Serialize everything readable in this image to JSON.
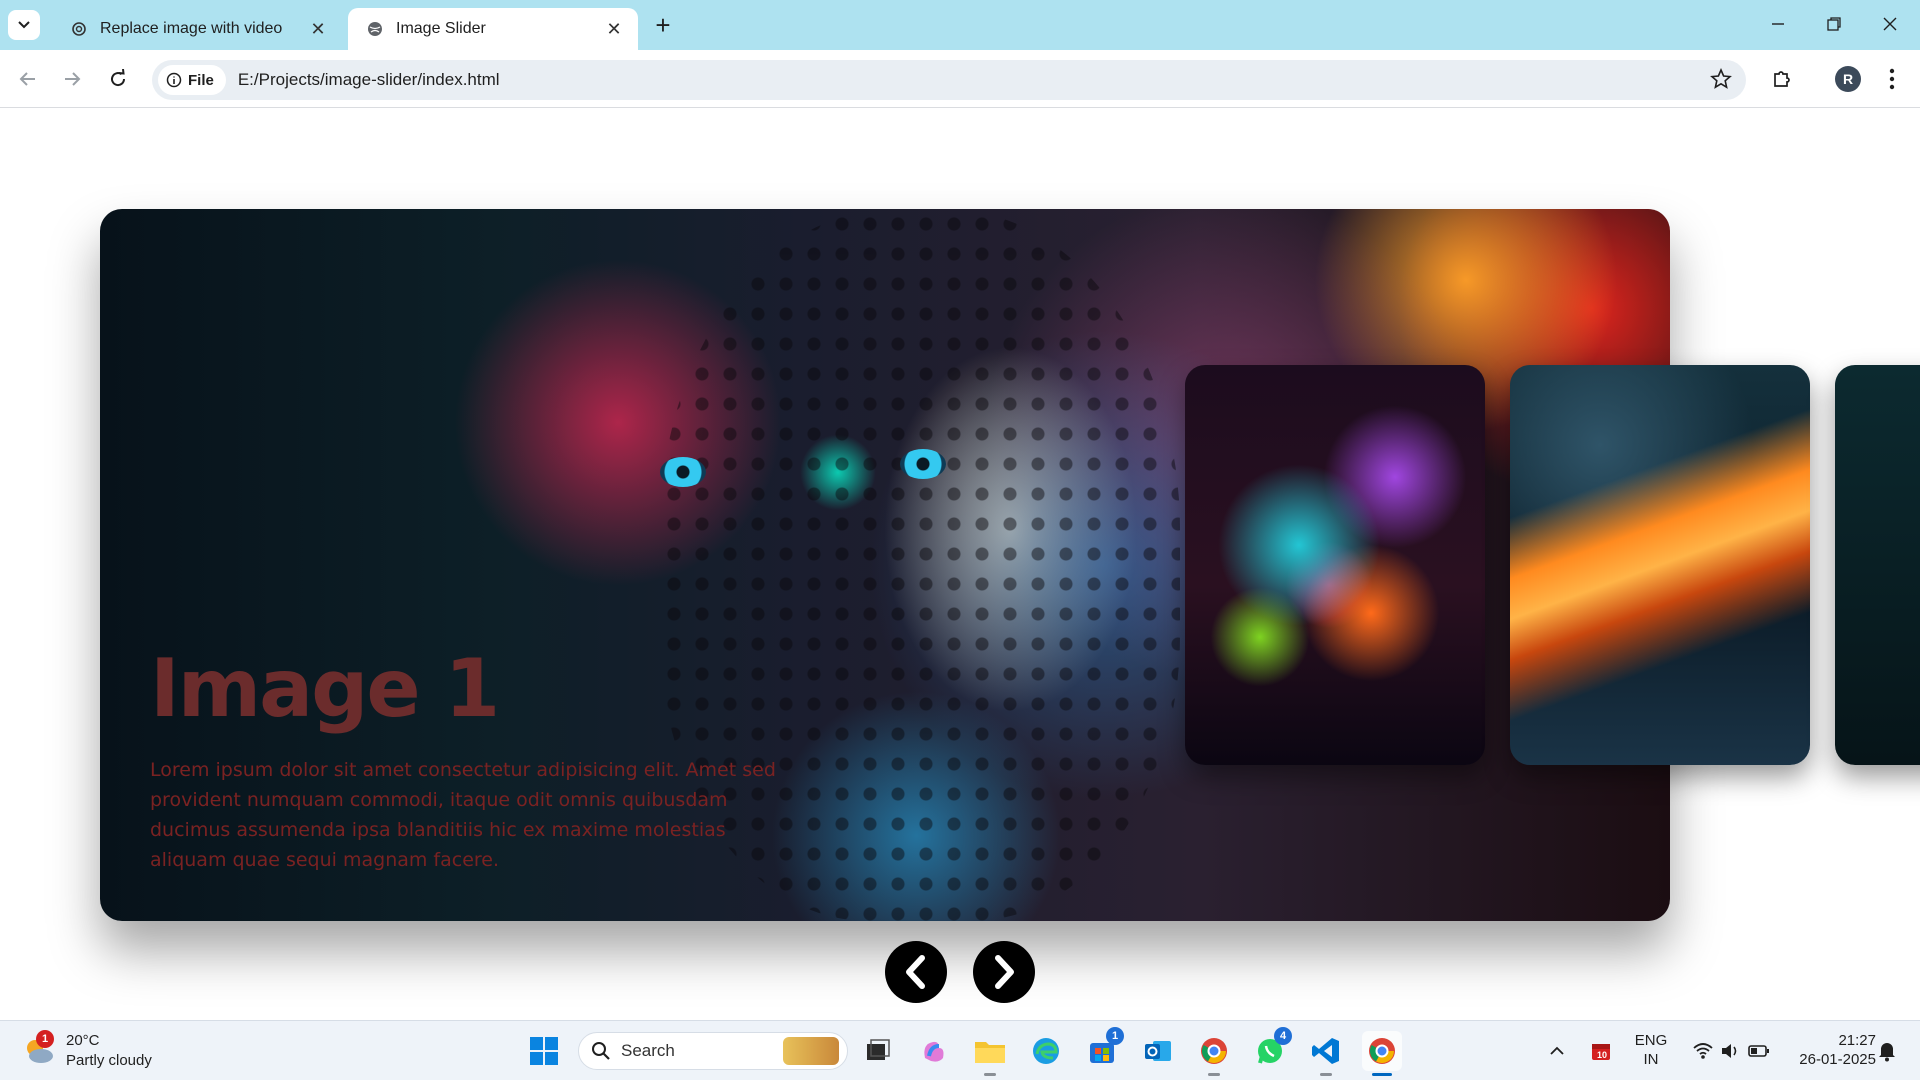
{
  "browser": {
    "tabs": [
      {
        "title": "Replace image with video",
        "favicon": "openai-icon",
        "active": false
      },
      {
        "title": "Image Slider",
        "favicon": "globe-icon",
        "active": true
      }
    ],
    "address": {
      "chip_label": "File",
      "url": "E:/Projects/image-slider/index.html"
    },
    "profile_initial": "R"
  },
  "page": {
    "slide": {
      "title": "Image 1",
      "description": "Lorem ipsum dolor sit amet consectetur adipisicing elit. Amet sed provident numquam commodi, itaque odit omnis quibusdam ducimus assumenda ipsa blanditiis hic ex maxime molestias aliquam quae sequi magnam facere."
    },
    "prev_label": "‹",
    "next_label": "›"
  },
  "taskbar": {
    "weather": {
      "temp": "20°C",
      "condition": "Partly cloudy",
      "badge": "1"
    },
    "search_label": "Search",
    "store_badge": "1",
    "whatsapp_badge": "4",
    "calendar_day": "10",
    "lang_top": "ENG",
    "lang_bottom": "IN",
    "time": "21:27",
    "date": "26-01-2025",
    "colors": {
      "accent": "#0067c0",
      "badge": "#d42020"
    }
  }
}
